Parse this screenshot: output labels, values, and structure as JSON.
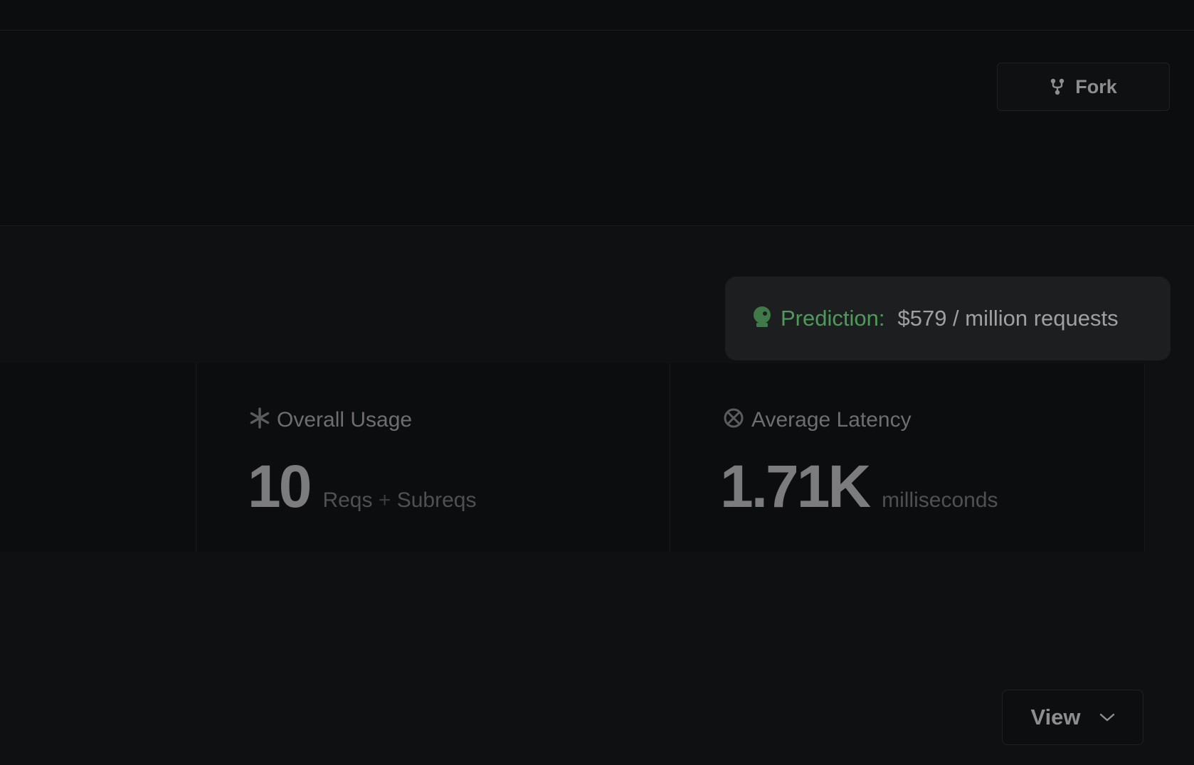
{
  "toolbar": {
    "fork_label": "Fork",
    "fork_icon": "git-fork-icon"
  },
  "prediction": {
    "icon": "crystal-ball-icon",
    "label": "Prediction:",
    "value": "$579 / million requests",
    "label_color": "#4f9a5b"
  },
  "stats": [
    {
      "icon": "asterisk-icon",
      "title": "Overall Usage",
      "value": "10",
      "unit_prefix": "Reqs",
      "unit_plus": "+",
      "unit_suffix": "Subreqs"
    },
    {
      "icon": "latency-icon",
      "title": "Average Latency",
      "value": "1.71K",
      "unit": "milliseconds"
    }
  ],
  "view": {
    "label": "View",
    "icon": "chevron-down-icon"
  }
}
